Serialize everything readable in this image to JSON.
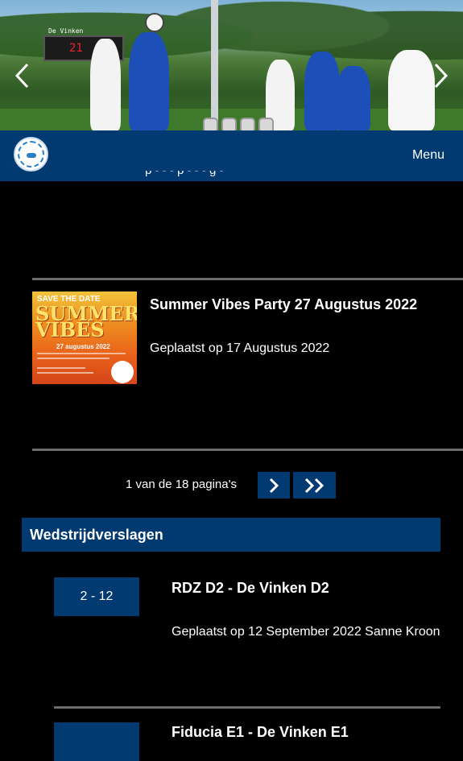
{
  "carousel": {
    "scoreboard_team": "De Vinken",
    "scoreboard_value": "21",
    "slide_count": 4,
    "active_slide": 1
  },
  "header": {
    "menu_label": "Menu",
    "brand_color": "#003a70"
  },
  "previous_item_fragment": "p - - - p - - - g -",
  "news": {
    "items": [
      {
        "thumb_save_the_date": "SAVE THE DATE",
        "thumb_title": "SUMMER VIBES",
        "thumb_date": "27 augustus 2022",
        "title": "Summer Vibes Party 27 Augustus 2022",
        "posted": "Geplaatst op 17 Augustus 2022"
      }
    ]
  },
  "pagination": {
    "text": "1 van de 18 pagina's"
  },
  "match_reports": {
    "heading": "Wedstrijdverslagen",
    "items": [
      {
        "score": "2 - 12",
        "title": "RDZ D2 - De Vinken D2",
        "meta": "Geplaatst op 12 September 2022 Sanne Kroon"
      },
      {
        "score": "",
        "title": "Fiducia E1 - De Vinken E1",
        "meta": ""
      }
    ]
  }
}
